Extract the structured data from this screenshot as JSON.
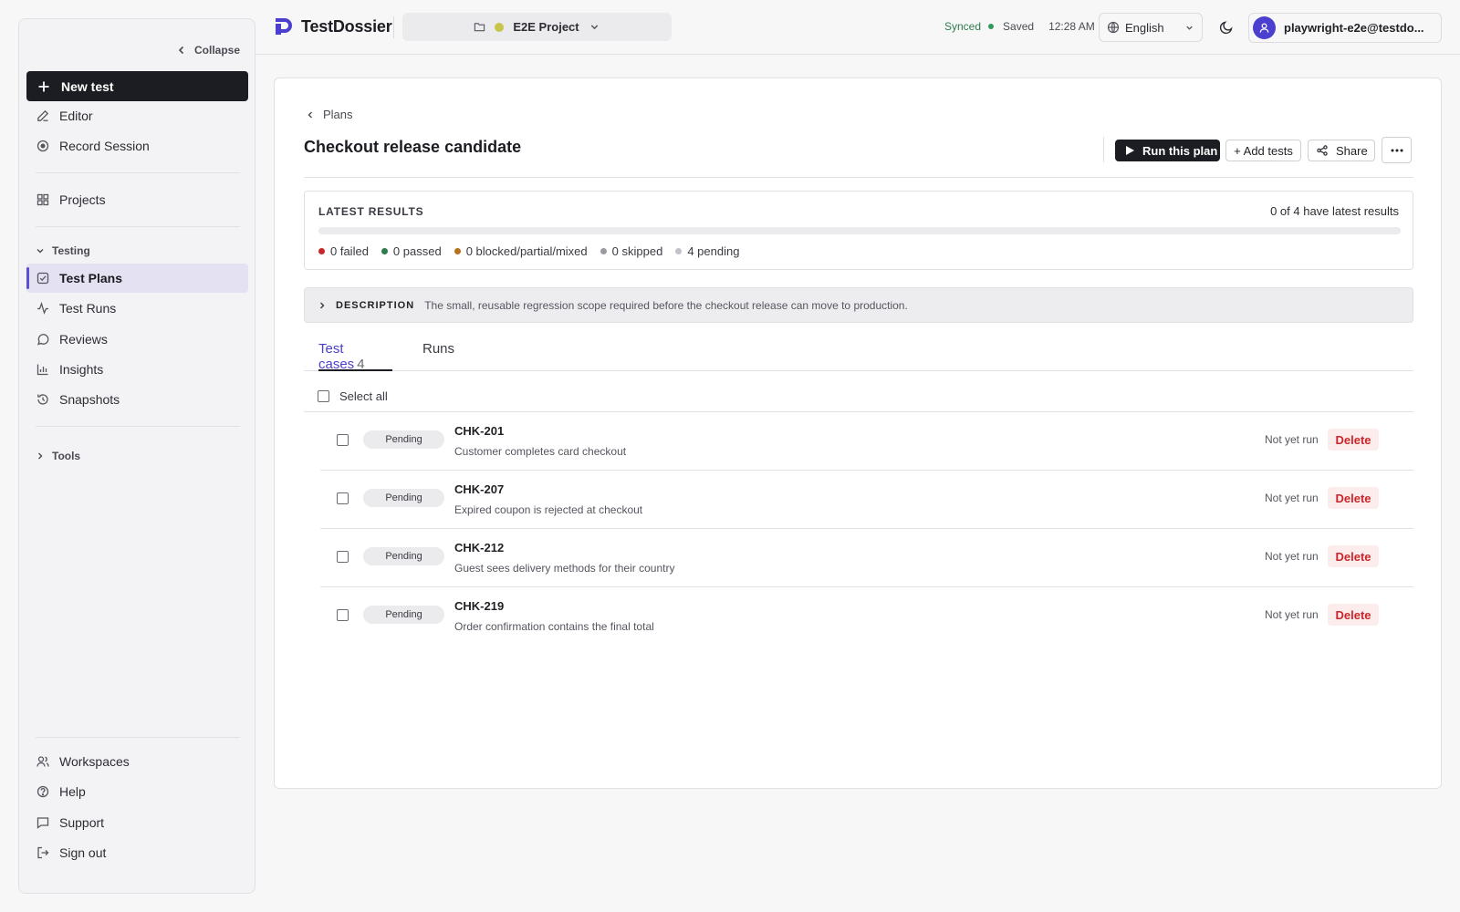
{
  "sidebar": {
    "collapse_label": "Collapse",
    "new_test_label": "New test",
    "top_items": [
      {
        "label": "Editor",
        "icon": "pencil-icon"
      },
      {
        "label": "Record Session",
        "icon": "record-icon"
      }
    ],
    "projects_label": "Projects",
    "testing_section_label": "Testing",
    "testing_items": [
      {
        "label": "Test Plans",
        "icon": "checklist-icon",
        "active": true
      },
      {
        "label": "Test Runs",
        "icon": "activity-icon"
      },
      {
        "label": "Reviews",
        "icon": "message-icon"
      },
      {
        "label": "Insights",
        "icon": "bar-chart-icon"
      },
      {
        "label": "Snapshots",
        "icon": "history-icon"
      }
    ],
    "tools_section_label": "Tools",
    "bottom_items": [
      {
        "label": "Workspaces",
        "icon": "users-icon"
      },
      {
        "label": "Help",
        "icon": "help-circle-icon"
      },
      {
        "label": "Support",
        "icon": "chat-icon"
      },
      {
        "label": "Sign out",
        "icon": "sign-out-icon"
      }
    ]
  },
  "header": {
    "brand": "TestDossier",
    "project_name": "E2E Project",
    "sync_status": "Synced",
    "save_status": "Saved",
    "time": "12:28 AM",
    "language": "English",
    "account": "playwright-e2e@testdo..."
  },
  "plan": {
    "breadcrumb": "Plans",
    "title": "Checkout release candidate",
    "run_label": "Run this plan",
    "add_tests_label": "+ Add tests",
    "share_label": "Share",
    "results_label": "LATEST RESULTS",
    "results_count": "0 of 4 have latest results",
    "progress_fraction": 0,
    "legend": [
      {
        "label": "0 failed",
        "color": "#c9262a"
      },
      {
        "label": "0 passed",
        "color": "#2f7a4f"
      },
      {
        "label": "0 blocked/partial/mixed",
        "color": "#b8701a"
      },
      {
        "label": "0 skipped",
        "color": "#9a9ba2"
      },
      {
        "label": "4 pending",
        "color": "#c2c3c8"
      }
    ],
    "description_label": "DESCRIPTION",
    "description": "The small, reusable regression scope required before the checkout release can move to production.",
    "tabs": {
      "cases_label": "Test cases",
      "cases_count": "4",
      "runs_label": "Runs"
    },
    "select_all_label": "Select all",
    "cases": [
      {
        "status": "Pending",
        "id": "CHK-201",
        "title": "Customer completes card checkout",
        "last_run": "Not yet run",
        "delete_label": "Delete"
      },
      {
        "status": "Pending",
        "id": "CHK-207",
        "title": "Expired coupon is rejected at checkout",
        "last_run": "Not yet run",
        "delete_label": "Delete"
      },
      {
        "status": "Pending",
        "id": "CHK-212",
        "title": "Guest sees delivery methods for their country",
        "last_run": "Not yet run",
        "delete_label": "Delete"
      },
      {
        "status": "Pending",
        "id": "CHK-219",
        "title": "Order confirmation contains the final total",
        "last_run": "Not yet run",
        "delete_label": "Delete"
      }
    ]
  },
  "colors": {
    "accent": "#4b3fd0",
    "primary_dark": "#1c1d22",
    "danger": "#c9262a"
  }
}
